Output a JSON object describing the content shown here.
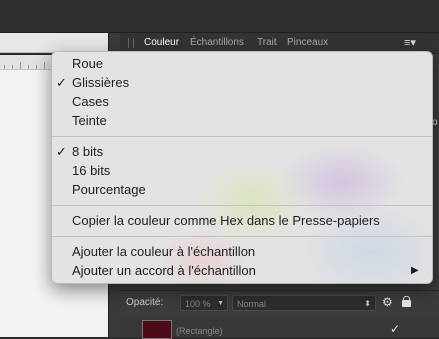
{
  "panel": {
    "tabs": [
      "Couleur",
      "Échantillons",
      "Trait",
      "Pinceaux"
    ],
    "menu_icon": "≡▾"
  },
  "opacity_row": {
    "label": "Opacité:",
    "opacity_value": "100 %",
    "blend_mode": "Normal"
  },
  "layer": {
    "name": "(Rectangle)",
    "thumbnail_color": "#4a0a16"
  },
  "edge_char": "o",
  "menu": {
    "items": [
      {
        "label": "Roue",
        "checked": false
      },
      {
        "label": "Glissières",
        "checked": true
      },
      {
        "label": "Cases",
        "checked": false
      },
      {
        "label": "Teinte",
        "checked": false
      },
      {
        "label": "8 bits",
        "checked": true
      },
      {
        "label": "16 bits",
        "checked": false
      },
      {
        "label": "Pourcentage",
        "checked": false
      },
      {
        "label": "Copier la couleur comme Hex dans le Presse-papiers",
        "checked": false
      },
      {
        "label": "Ajouter la couleur à l'échantillon",
        "checked": false
      },
      {
        "label": "Ajouter un accord à l'échantillon",
        "checked": false,
        "submenu": true
      }
    ],
    "check_glyph": "✓",
    "submenu_glyph": "▶"
  }
}
